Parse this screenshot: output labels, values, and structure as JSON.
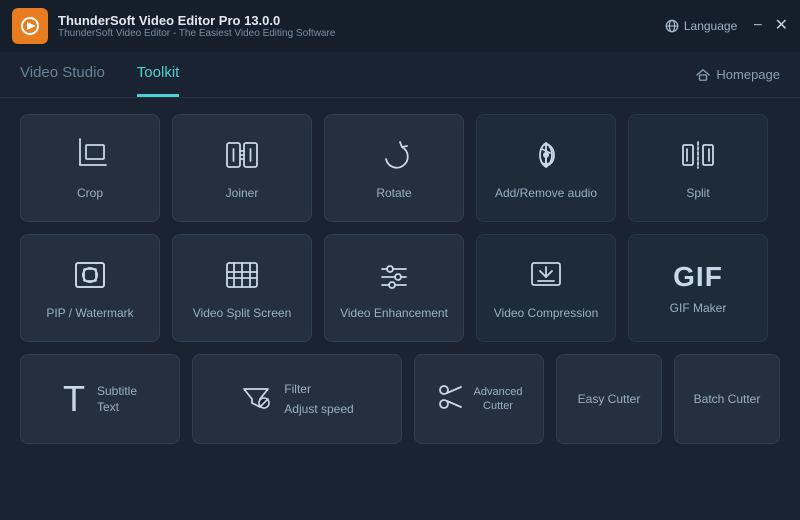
{
  "titlebar": {
    "app_name": "ThunderSoft Video Editor Pro 13.0.0",
    "app_subtitle": "ThunderSoft Video Editor - The Easiest Video Editing Software",
    "language_label": "Language",
    "homepage_label": "Homepage"
  },
  "nav": {
    "tabs": [
      {
        "id": "video-studio",
        "label": "Video Studio"
      },
      {
        "id": "toolkit",
        "label": "Toolkit"
      }
    ],
    "active_tab": "toolkit"
  },
  "tools": {
    "row1": [
      {
        "id": "crop",
        "label": "Crop",
        "icon": "crop"
      },
      {
        "id": "joiner",
        "label": "Joiner",
        "icon": "joiner"
      },
      {
        "id": "rotate",
        "label": "Rotate",
        "icon": "rotate"
      },
      {
        "id": "add-remove-audio",
        "label": "Add/Remove audio",
        "icon": "audio"
      },
      {
        "id": "split",
        "label": "Split",
        "icon": "split"
      }
    ],
    "row2": [
      {
        "id": "pip-watermark",
        "label": "PIP / Watermark",
        "icon": "pip"
      },
      {
        "id": "video-split-screen",
        "label": "Video Split Screen",
        "icon": "split-screen"
      },
      {
        "id": "video-enhancement",
        "label": "Video Enhancement",
        "icon": "enhancement"
      },
      {
        "id": "video-compression",
        "label": "Video Compression",
        "icon": "compression"
      },
      {
        "id": "gif-maker",
        "label": "GIF Maker",
        "icon": "gif"
      }
    ],
    "row3": {
      "subtitle_top": "Subtitle",
      "subtitle_bottom": "Text",
      "filter_label": "Filter",
      "adjust_label": "Adjust speed",
      "advanced_cutter_line1": "Advanced",
      "advanced_cutter_line2": "Cutter",
      "easy_cutter": "Easy Cutter",
      "batch_cutter": "Batch Cutter"
    }
  }
}
